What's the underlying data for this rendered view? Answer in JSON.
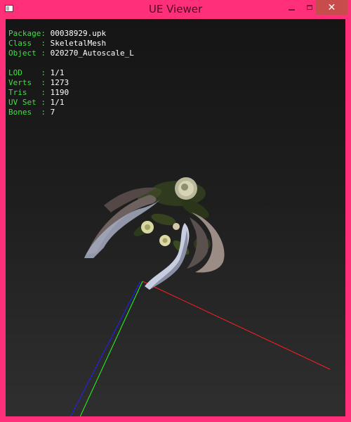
{
  "window": {
    "title": "UE Viewer",
    "close_label": "✕"
  },
  "info": {
    "package_label": "Package: ",
    "package_value": "00038929.upk",
    "class_label": "Class  : ",
    "class_value": "SkeletalMesh",
    "object_label": "Object : ",
    "object_value": "020270_Autoscale_L",
    "lod_label": "LOD    : ",
    "lod_value": "1/1",
    "verts_label": "Verts  : ",
    "verts_value": "1273",
    "tris_label": "Tris   : ",
    "tris_value": "1190",
    "uvset_label": "UV Set : ",
    "uvset_value": "1/1",
    "bones_label": "Bones  : ",
    "bones_value": "7"
  },
  "colors": {
    "frame": "#ff2f7a",
    "label_green": "#3fe03f",
    "axis_x": "#ff2020",
    "axis_y": "#20ff20",
    "axis_z": "#2020ff"
  }
}
